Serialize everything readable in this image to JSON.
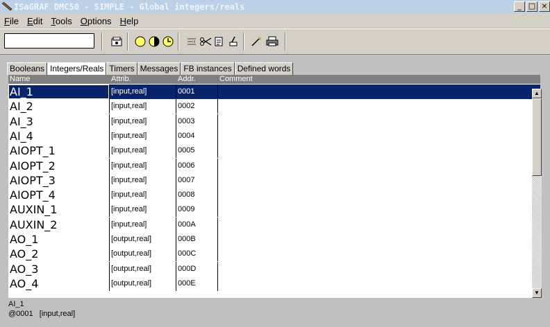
{
  "window": {
    "title": "ISaGRAF DMC50 - SIMPLE - Global integers/reals",
    "minimize": "_",
    "maximize": "□",
    "close": "×"
  },
  "menu": [
    {
      "label": "File",
      "accel": "F",
      "rest": "ile"
    },
    {
      "label": "Edit",
      "accel": "E",
      "rest": "dit"
    },
    {
      "label": "Tools",
      "accel": "T",
      "rest": "ools"
    },
    {
      "label": "Options",
      "accel": "O",
      "rest": "ptions"
    },
    {
      "label": "Help",
      "accel": "H",
      "rest": "elp"
    }
  ],
  "toolbar": {
    "input_value": "",
    "icons": [
      "open-icon",
      "circle-yellow-icon",
      "circle-half-icon",
      "clock-icon",
      "align-icon",
      "cut-icon",
      "copy-icon",
      "paste-icon",
      "wand-icon",
      "print-icon"
    ]
  },
  "tabs": [
    {
      "label": "Booleans",
      "active": false
    },
    {
      "label": "Integers/Reals",
      "active": true
    },
    {
      "label": "Timers",
      "active": false
    },
    {
      "label": "Messages",
      "active": false
    },
    {
      "label": "FB instances",
      "active": false
    },
    {
      "label": "Defined words",
      "active": false
    }
  ],
  "grid": {
    "headers": {
      "name": "Name",
      "attrib": "Attrib.",
      "addr": "Addr.",
      "comment": "Comment"
    },
    "rows": [
      {
        "name": "AI_1",
        "attrib": "[input,real]",
        "addr": "0001",
        "comment": ""
      },
      {
        "name": "AI_2",
        "attrib": "[input,real]",
        "addr": "0002",
        "comment": ""
      },
      {
        "name": "AI_3",
        "attrib": "[input,real]",
        "addr": "0003",
        "comment": ""
      },
      {
        "name": "AI_4",
        "attrib": "[input,real]",
        "addr": "0004",
        "comment": ""
      },
      {
        "name": "AIOPT_1",
        "attrib": "[input,real]",
        "addr": "0005",
        "comment": ""
      },
      {
        "name": "AIOPT_2",
        "attrib": "[input,real]",
        "addr": "0006",
        "comment": ""
      },
      {
        "name": "AIOPT_3",
        "attrib": "[input,real]",
        "addr": "0007",
        "comment": ""
      },
      {
        "name": "AIOPT_4",
        "attrib": "[input,real]",
        "addr": "0008",
        "comment": ""
      },
      {
        "name": "AUXIN_1",
        "attrib": "[input,real]",
        "addr": "0009",
        "comment": ""
      },
      {
        "name": "AUXIN_2",
        "attrib": "[input,real]",
        "addr": "000A",
        "comment": ""
      },
      {
        "name": "AO_1",
        "attrib": "[output,real]",
        "addr": "000B",
        "comment": ""
      },
      {
        "name": "AO_2",
        "attrib": "[output,real]",
        "addr": "000C",
        "comment": ""
      },
      {
        "name": "AO_3",
        "attrib": "[output,real]",
        "addr": "000D",
        "comment": ""
      },
      {
        "name": "AO_4",
        "attrib": "[output,real]",
        "addr": "000E",
        "comment": ""
      }
    ],
    "selected_index": 0
  },
  "status": {
    "line1": "AI_1",
    "line2": "@0001   [input,real]"
  },
  "colors": {
    "title_bar": "#bcd0e8",
    "selection": "#0a246a",
    "header": "#808080"
  }
}
